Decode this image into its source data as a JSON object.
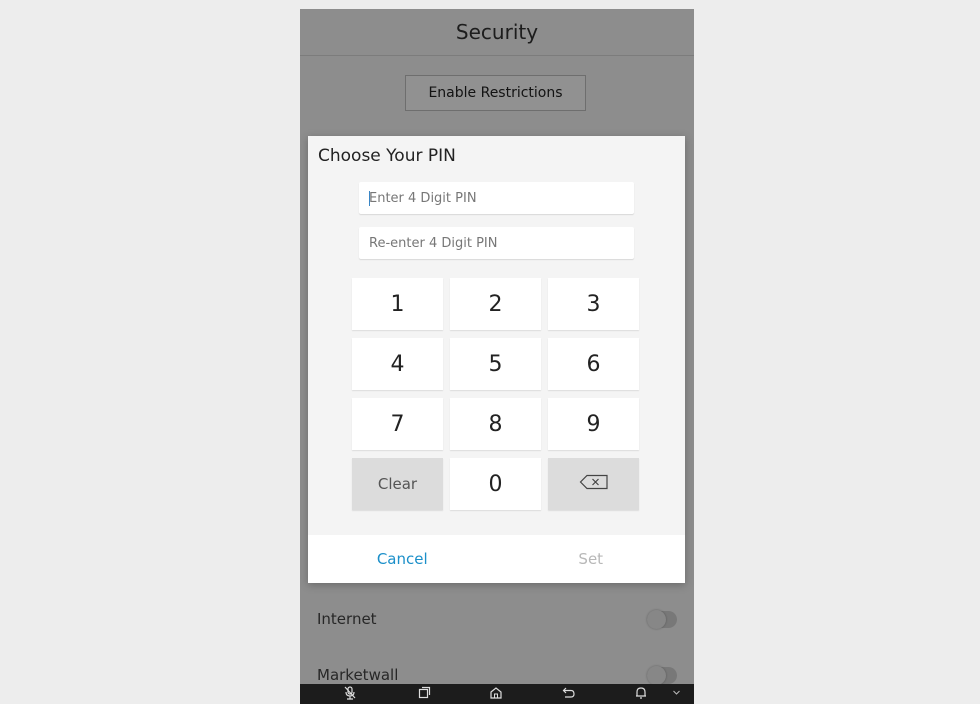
{
  "screen": {
    "title": "Security",
    "enable_restrictions": "Enable Restrictions",
    "rows": [
      {
        "label": "Internet"
      },
      {
        "label": "Marketwall"
      }
    ]
  },
  "dialog": {
    "title": "Choose Your PIN",
    "pin_placeholder": "Enter 4 Digit PIN",
    "reenter_placeholder": "Re-enter 4 Digit PIN",
    "keys": [
      "1",
      "2",
      "3",
      "4",
      "5",
      "6",
      "7",
      "8",
      "9",
      "Clear",
      "0",
      "backspace"
    ],
    "clear_label": "Clear",
    "cancel_label": "Cancel",
    "set_label": "Set"
  },
  "navbar": {
    "icons": [
      "mic-icon",
      "recent-apps-icon",
      "home-icon",
      "back-icon",
      "bell-icon",
      "chevron-down-icon"
    ]
  },
  "colors": {
    "accent": "#1b8fc9",
    "disabled": "#b8b8b8"
  }
}
